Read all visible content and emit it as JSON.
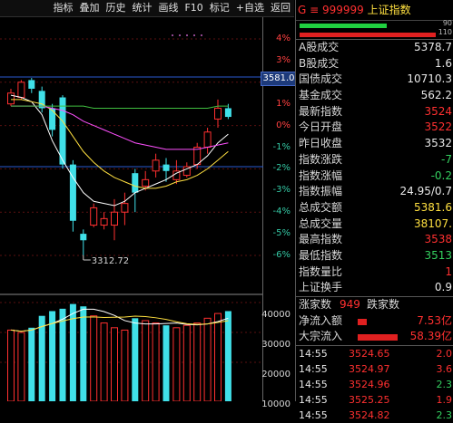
{
  "toolbar": {
    "items": [
      "指标",
      "叠加",
      "历史",
      "统计",
      "画线",
      "F10",
      "标记",
      "+自选",
      "返回"
    ]
  },
  "scale": {
    "pct_ticks": [
      {
        "label": "4%",
        "cls": "up"
      },
      {
        "label": "3%",
        "cls": "up"
      },
      {
        "label": "2%",
        "cls": "up"
      },
      {
        "label": "1%",
        "cls": "up"
      },
      {
        "label": "0%",
        "cls": "zero"
      },
      {
        "label": "-1%",
        "cls": "dn"
      },
      {
        "label": "-2%",
        "cls": "dn"
      },
      {
        "label": "-3%",
        "cls": "dn"
      },
      {
        "label": "-4%",
        "cls": "dn"
      },
      {
        "label": "-5%",
        "cls": "dn"
      },
      {
        "label": "-6%",
        "cls": "dn"
      }
    ],
    "vol_ticks": [
      "40000",
      "30000",
      "20000",
      "10000"
    ],
    "price_marker": "3581.0",
    "low_marker": "3312.72"
  },
  "panel": {
    "title_code": "G ≡ 999999",
    "title_name": "上证指数",
    "bar1_num": "90",
    "bar2_num": "110",
    "rows": [
      {
        "label": "A股成交",
        "value": "5378.7",
        "color": "white"
      },
      {
        "label": "B股成交",
        "value": "1.6",
        "color": "white"
      },
      {
        "label": "国债成交",
        "value": "10710.3",
        "color": "white"
      },
      {
        "label": "基金成交",
        "value": "562.2",
        "color": "white"
      },
      {
        "label": "最新指数",
        "value": "3524",
        "color": "red"
      },
      {
        "label": "今日开盘",
        "value": "3522",
        "color": "red"
      },
      {
        "label": "昨日收盘",
        "value": "3532",
        "color": "white"
      },
      {
        "label": "指数涨跌",
        "value": "-7",
        "color": "green"
      },
      {
        "label": "指数涨幅",
        "value": "-0.2",
        "color": "green"
      },
      {
        "label": "指数振幅",
        "value": "24.95/0.7",
        "color": "white"
      },
      {
        "label": "总成交额",
        "value": "5381.6",
        "color": "yellow"
      },
      {
        "label": "总成交量",
        "value": "38107.",
        "color": "yellow"
      },
      {
        "label": "最高指数",
        "value": "3538",
        "color": "red"
      },
      {
        "label": "最低指数",
        "value": "3513",
        "color": "green"
      },
      {
        "label": "指数量比",
        "value": "1",
        "color": "red"
      },
      {
        "label": "上证换手",
        "value": "0.9",
        "color": "white"
      }
    ],
    "adv_label": "涨家数",
    "adv_value": "949",
    "dec_label": "跌家数",
    "net_inflow_label": "净流入额",
    "net_inflow_value": "7.53亿",
    "block_inflow_label": "大宗流入",
    "block_inflow_value": "58.39亿",
    "ticks": [
      {
        "time": "14:55",
        "price": "3524.65",
        "vol": "2.0",
        "vcolor": "red"
      },
      {
        "time": "14:55",
        "price": "3524.97",
        "vol": "3.6",
        "vcolor": "red"
      },
      {
        "time": "14:55",
        "price": "3524.96",
        "vol": "2.3",
        "vcolor": "green"
      },
      {
        "time": "14:55",
        "price": "3525.25",
        "vol": "1.9",
        "vcolor": "red"
      },
      {
        "time": "14:55",
        "price": "3524.82",
        "vol": "2.3",
        "vcolor": "green"
      }
    ]
  },
  "chart_data": {
    "type": "candlestick",
    "y_axis": {
      "label_format": "percent",
      "range_pct": [
        -6.5,
        4.5
      ]
    },
    "markers": {
      "last_price": 3581.0,
      "low": 3312.72
    },
    "candles_pct": [
      {
        "o": 1.0,
        "c": 1.5,
        "h": 1.7,
        "l": 0.9
      },
      {
        "o": 1.3,
        "c": 2.0,
        "h": 2.1,
        "l": 1.2
      },
      {
        "o": 2.1,
        "c": 1.7,
        "h": 2.2,
        "l": 1.5
      },
      {
        "o": 1.6,
        "c": 0.8,
        "h": 1.8,
        "l": 0.6
      },
      {
        "o": 0.8,
        "c": -0.2,
        "h": 1.0,
        "l": -0.5
      },
      {
        "o": 1.3,
        "c": -1.8,
        "h": 1.4,
        "l": -2.0
      },
      {
        "o": -1.8,
        "c": -4.4,
        "h": -1.6,
        "l": -4.9
      },
      {
        "o": -5.0,
        "c": -5.3,
        "h": -4.8,
        "l": -6.0
      },
      {
        "o": -4.6,
        "c": -3.8,
        "h": -3.6,
        "l": -4.7
      },
      {
        "o": -4.6,
        "c": -4.3,
        "h": -4.0,
        "l": -4.8
      },
      {
        "o": -4.6,
        "c": -4.0,
        "h": -3.4,
        "l": -5.3
      },
      {
        "o": -4.0,
        "c": -3.6,
        "h": -3.1,
        "l": -4.6
      },
      {
        "o": -2.2,
        "c": -3.1,
        "h": -2.0,
        "l": -4.0
      },
      {
        "o": -2.8,
        "c": -2.5,
        "h": -2.1,
        "l": -3.0
      },
      {
        "o": -2.1,
        "c": -1.6,
        "h": -1.3,
        "l": -2.4
      },
      {
        "o": -1.8,
        "c": -2.1,
        "h": -1.5,
        "l": -2.6
      },
      {
        "o": -2.5,
        "c": -2.1,
        "h": -1.6,
        "l": -2.7
      },
      {
        "o": -2.3,
        "c": -1.9,
        "h": -1.7,
        "l": -2.4
      },
      {
        "o": -1.8,
        "c": -1.0,
        "h": -0.8,
        "l": -2.0
      },
      {
        "o": -1.0,
        "c": -0.3,
        "h": -0.1,
        "l": -1.3
      },
      {
        "o": 0.3,
        "c": 0.8,
        "h": 1.2,
        "l": -0.1
      },
      {
        "o": 0.8,
        "c": 0.4,
        "h": 1.0,
        "l": 0.3
      }
    ],
    "ma_lines": [
      {
        "name": "MA5",
        "color": "#ffffff",
        "values": [
          1.4,
          1.3,
          1.1,
          0.5,
          -0.7,
          -1.6,
          -2.4,
          -3.1,
          -3.5,
          -3.6,
          -3.7,
          -3.5,
          -3.1,
          -2.9,
          -2.7,
          -2.5,
          -2.2,
          -2.0,
          -1.8,
          -1.4,
          -0.8,
          -0.4
        ]
      },
      {
        "name": "MA10",
        "color": "#ffe040",
        "values": [
          1.2,
          1.2,
          1.1,
          1.0,
          0.7,
          0.2,
          -0.5,
          -1.2,
          -1.7,
          -2.1,
          -2.4,
          -2.6,
          -2.8,
          -2.9,
          -2.9,
          -2.8,
          -2.6,
          -2.5,
          -2.3,
          -2.0,
          -1.6,
          -1.2
        ]
      },
      {
        "name": "MA20",
        "color": "#ff50ff",
        "values": [
          0.9,
          0.9,
          0.9,
          0.9,
          0.8,
          0.7,
          0.5,
          0.2,
          0.0,
          -0.2,
          -0.4,
          -0.6,
          -0.8,
          -0.9,
          -1.0,
          -1.1,
          -1.1,
          -1.1,
          -1.1,
          -1.0,
          -0.9,
          -0.8
        ]
      },
      {
        "name": "MA60",
        "color": "#40c040",
        "values": [
          0.9,
          0.9,
          0.9,
          0.9,
          0.9,
          0.9,
          0.9,
          0.9,
          0.8,
          0.8,
          0.8,
          0.8,
          0.8,
          0.8,
          0.8,
          0.8,
          0.8,
          0.8,
          0.8,
          0.8,
          0.9,
          0.9
        ]
      }
    ],
    "volume": [
      30000,
      29000,
      31000,
      36000,
      38000,
      39000,
      41000,
      40000,
      36000,
      33000,
      31000,
      30000,
      35000,
      34000,
      33000,
      32000,
      31000,
      32000,
      33000,
      35000,
      37000,
      38000
    ]
  }
}
